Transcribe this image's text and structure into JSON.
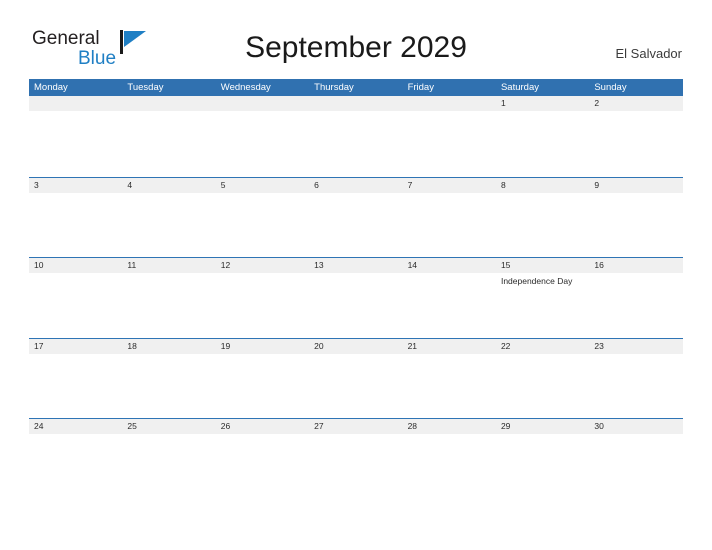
{
  "brand": {
    "name_part1": "General",
    "name_part2": "Blue",
    "flag_icon": "blue-flag-triangle",
    "accent_color": "#1f7fc4"
  },
  "header": {
    "title": "September 2029",
    "region": "El Salvador"
  },
  "calendar": {
    "header_color": "#3071b0",
    "band_color": "#f0f0f0",
    "rule_color": "#2e74b5",
    "weekdays": [
      "Monday",
      "Tuesday",
      "Wednesday",
      "Thursday",
      "Friday",
      "Saturday",
      "Sunday"
    ],
    "weeks": [
      [
        {
          "day": "",
          "event": ""
        },
        {
          "day": "",
          "event": ""
        },
        {
          "day": "",
          "event": ""
        },
        {
          "day": "",
          "event": ""
        },
        {
          "day": "",
          "event": ""
        },
        {
          "day": "1",
          "event": ""
        },
        {
          "day": "2",
          "event": ""
        }
      ],
      [
        {
          "day": "3",
          "event": ""
        },
        {
          "day": "4",
          "event": ""
        },
        {
          "day": "5",
          "event": ""
        },
        {
          "day": "6",
          "event": ""
        },
        {
          "day": "7",
          "event": ""
        },
        {
          "day": "8",
          "event": ""
        },
        {
          "day": "9",
          "event": ""
        }
      ],
      [
        {
          "day": "10",
          "event": ""
        },
        {
          "day": "11",
          "event": ""
        },
        {
          "day": "12",
          "event": ""
        },
        {
          "day": "13",
          "event": ""
        },
        {
          "day": "14",
          "event": ""
        },
        {
          "day": "15",
          "event": "Independence Day"
        },
        {
          "day": "16",
          "event": ""
        }
      ],
      [
        {
          "day": "17",
          "event": ""
        },
        {
          "day": "18",
          "event": ""
        },
        {
          "day": "19",
          "event": ""
        },
        {
          "day": "20",
          "event": ""
        },
        {
          "day": "21",
          "event": ""
        },
        {
          "day": "22",
          "event": ""
        },
        {
          "day": "23",
          "event": ""
        }
      ],
      [
        {
          "day": "24",
          "event": ""
        },
        {
          "day": "25",
          "event": ""
        },
        {
          "day": "26",
          "event": ""
        },
        {
          "day": "27",
          "event": ""
        },
        {
          "day": "28",
          "event": ""
        },
        {
          "day": "29",
          "event": ""
        },
        {
          "day": "30",
          "event": ""
        }
      ]
    ]
  }
}
